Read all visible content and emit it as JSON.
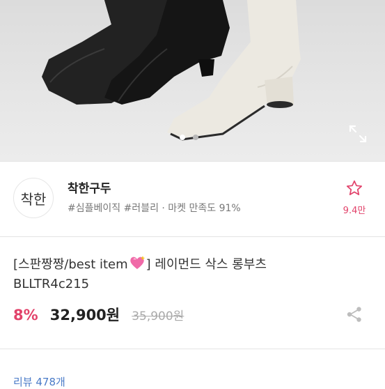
{
  "hero": {
    "slides": 2,
    "active_slide": 1
  },
  "shop": {
    "logo_text": "착한",
    "name": "착한구두",
    "tags": "#심플베이직 #러블리 · 마켓 만족도 91%",
    "favorites": "9.4만"
  },
  "product": {
    "title_prefix": "[스판짱짱/best item",
    "title_suffix": "] 레이먼드 삭스 롱부츠",
    "code": "BLLTR4c215",
    "discount": "8%",
    "price": "32,900원",
    "original_price": "35,900원"
  },
  "reviews": {
    "label": "리뷰 478개"
  },
  "colors": {
    "accent": "#e2436b",
    "link": "#4a7bc8"
  }
}
